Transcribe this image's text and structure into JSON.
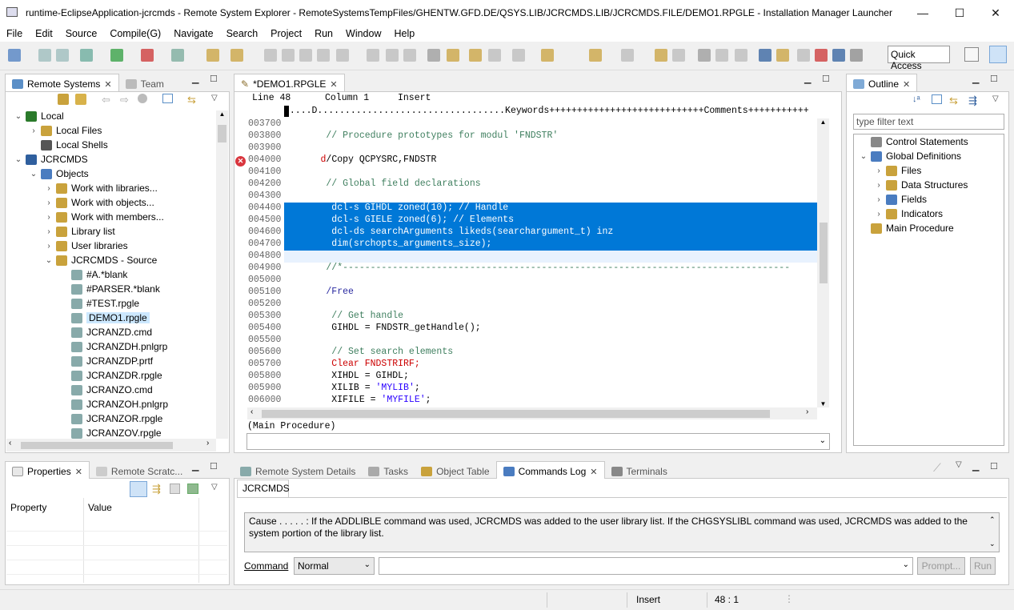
{
  "window": {
    "title": "runtime-EclipseApplication-jcrcmds - Remote System Explorer - RemoteSystemsTempFiles/GHENTW.GFD.DE/QSYS.LIB/JCRCMDS.LIB/JCRCMDS.FILE/DEMO1.RPGLE - Installation Manager Launcher",
    "min": "—",
    "max": "☐",
    "close": "✕"
  },
  "menu": [
    "File",
    "Edit",
    "Source",
    "Compile(G)",
    "Navigate",
    "Search",
    "Project",
    "Run",
    "Window",
    "Help"
  ],
  "toolbar": {
    "quick_access": "Quick Access"
  },
  "remote_systems": {
    "tab_label": "Remote Systems",
    "tab2_label": "Team",
    "tree": [
      {
        "label": "Local",
        "twist": "⌄"
      },
      {
        "label": "Local Files",
        "twist": "›"
      },
      {
        "label": "Local Shells",
        "twist": ""
      },
      {
        "label": "JCRCMDS",
        "twist": "⌄"
      },
      {
        "label": "Objects",
        "twist": "⌄"
      },
      {
        "label": "Work with libraries...",
        "twist": "›"
      },
      {
        "label": "Work with objects...",
        "twist": "›"
      },
      {
        "label": "Work with members...",
        "twist": "›"
      },
      {
        "label": "Library list",
        "twist": "›"
      },
      {
        "label": "User libraries",
        "twist": "›"
      },
      {
        "label": "JCRCMDS - Source",
        "twist": "⌄"
      },
      {
        "label": "#A.*blank",
        "twist": ""
      },
      {
        "label": "#PARSER.*blank",
        "twist": ""
      },
      {
        "label": "#TEST.rpgle",
        "twist": ""
      },
      {
        "label": "DEMO1.rpgle",
        "twist": ""
      },
      {
        "label": "JCRANZD.cmd",
        "twist": ""
      },
      {
        "label": "JCRANZDH.pnlgrp",
        "twist": ""
      },
      {
        "label": "JCRANZDP.prtf",
        "twist": ""
      },
      {
        "label": "JCRANZDR.rpgle",
        "twist": ""
      },
      {
        "label": "JCRANZO.cmd",
        "twist": ""
      },
      {
        "label": "JCRANZOH.pnlgrp",
        "twist": ""
      },
      {
        "label": "JCRANZOR.rpgle",
        "twist": ""
      },
      {
        "label": "JCRANZOV.rpgle",
        "twist": ""
      }
    ]
  },
  "editor": {
    "tab_label": "*DEMO1.RPGLE",
    "line_label": "Line 48",
    "column_label": "Column 1",
    "mode_label": "Insert",
    "ruler": ".....D..................................Keywords++++++++++++++++++++++++++++Comments+++++++++++",
    "lines": [
      {
        "num": "003700",
        "text": ""
      },
      {
        "num": "003800",
        "text": "      // Procedure prototypes for modul 'FNDSTR'"
      },
      {
        "num": "003900",
        "text": ""
      },
      {
        "num": "004000",
        "text": "     d/Copy QCPYSRC,FNDSTR"
      },
      {
        "num": "004100",
        "text": ""
      },
      {
        "num": "004200",
        "text": "      // Global field declarations"
      },
      {
        "num": "004300",
        "text": ""
      },
      {
        "num": "004400",
        "text": "       dcl-s GIHDL zoned(10); // Handle"
      },
      {
        "num": "004500",
        "text": "       dcl-s GIELE zoned(6); // Elements"
      },
      {
        "num": "004600",
        "text": "       dcl-ds searchArguments likeds(searchargument_t) inz"
      },
      {
        "num": "004700",
        "text": "       dim(srchopts_arguments_size);"
      },
      {
        "num": "004800",
        "text": ""
      },
      {
        "num": "004900",
        "text": "      //*---------------------------------------------------------------------------------"
      },
      {
        "num": "005000",
        "text": ""
      },
      {
        "num": "005100",
        "text": "      /Free"
      },
      {
        "num": "005200",
        "text": ""
      },
      {
        "num": "005300",
        "text": "       // Get handle"
      },
      {
        "num": "005400",
        "text": "       GIHDL = FNDSTR_getHandle();"
      },
      {
        "num": "005500",
        "text": ""
      },
      {
        "num": "005600",
        "text": "       // Set search elements"
      },
      {
        "num": "005700",
        "text": "       Clear FNDSTRIRF;"
      },
      {
        "num": "005800",
        "text": "       XIHDL = GIHDL;"
      },
      {
        "num": "005900",
        "text": "       XILIB = 'MYLIB';"
      },
      {
        "num": "006000",
        "text": "       XIFILE = 'MYFILE';"
      }
    ],
    "procedure_label": "(Main Procedure)"
  },
  "outline": {
    "tab_label": "Outline",
    "filter_placeholder": "type filter text",
    "tree": [
      {
        "label": "Control Statements",
        "twist": ""
      },
      {
        "label": "Global Definitions",
        "twist": "⌄"
      },
      {
        "label": "Files",
        "twist": "›"
      },
      {
        "label": "Data Structures",
        "twist": "›"
      },
      {
        "label": "Fields",
        "twist": "›"
      },
      {
        "label": "Indicators",
        "twist": "›"
      },
      {
        "label": "Main Procedure",
        "twist": ""
      }
    ]
  },
  "properties": {
    "tab_label": "Properties",
    "tab2_label": "Remote Scratc...",
    "col_property": "Property",
    "col_value": "Value"
  },
  "bottom": {
    "tabs": [
      "Remote System Details",
      "Tasks",
      "Object Table",
      "Commands Log",
      "Terminals"
    ],
    "system_tab": "JCRCMDS",
    "log_text": "Cause . . . . . :   If the ADDLIBLE command was used, JCRCMDS was added to the user library list.  If the CHGSYSLIBL command was used, JCRCMDS was added to the system portion of the library list.",
    "command_label": "Command",
    "command_mode": "Normal",
    "prompt_label": "Prompt...",
    "run_label": "Run"
  },
  "status": {
    "mode": "Insert",
    "position": "48 : 1"
  }
}
